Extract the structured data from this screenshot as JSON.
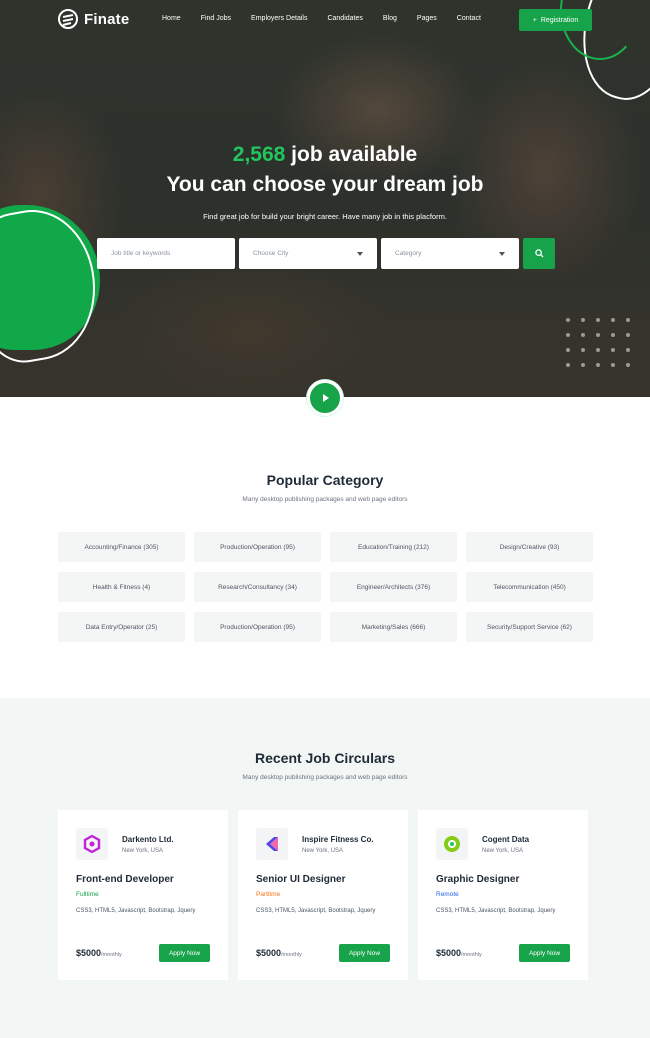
{
  "brand": {
    "name": "Finate",
    "accent": "#16a34a"
  },
  "nav": {
    "items": [
      "Home",
      "Find Jobs",
      "Employers Details",
      "Candidates",
      "Blog",
      "Pages",
      "Contact"
    ],
    "register_label": "Registration"
  },
  "hero": {
    "count": "2,568",
    "headline_rest": "job available",
    "headline_line2": "You can choose your dream job",
    "subtitle": "Find great job for build your bright career. Have many job in this placform.",
    "search": {
      "keyword_placeholder": "Job title or keywords",
      "city_placeholder": "Choose City",
      "category_placeholder": "Category"
    }
  },
  "categories": {
    "title": "Popular Category",
    "subtitle": "Many desktop publishing packages and web page editors",
    "items": [
      "Accounting/Finance (305)",
      "Production/Operation (95)",
      "Education/Training (212)",
      "Design/Creative (93)",
      "Health & Fitness (4)",
      "Research/Consultancy (34)",
      "Engineer/Architects (376)",
      "Telecommunication (450)",
      "Data Entry/Operator (25)",
      "Production/Operation (95)",
      "Marketing/Sales (666)",
      "Security/Support Service (62)"
    ]
  },
  "jobs": {
    "title": "Recent Job Circulars",
    "subtitle": "Many desktop publishing packages and web page editors",
    "cards": [
      {
        "company": "Darkento Ltd.",
        "location": "New York, USA",
        "title": "Front-end Developer",
        "type": "Fulltime",
        "type_color": "#16a34a",
        "skills": "CSS3, HTML5, Javascript, Bootstrap, Jquery",
        "salary": "$5000",
        "period": "/monthly",
        "apply_label": "Apply Now",
        "logo_color": "#c026d3"
      },
      {
        "company": "Inspire Fitness Co.",
        "location": "New York, USA",
        "title": "Senior UI Designer",
        "type": "Parttime",
        "type_color": "#f97316",
        "skills": "CSS3, HTML5, Javascript, Bootstrap, Jquery",
        "salary": "$5000",
        "period": "/monthly",
        "apply_label": "Apply Now",
        "logo_color": "#4f46e5"
      },
      {
        "company": "Cogent Data",
        "location": "New York, USA",
        "title": "Graphic Designer",
        "type": "Remote",
        "type_color": "#2563eb",
        "skills": "CSS3, HTML5, Javascript, Bootstrap, Jquery",
        "salary": "$5000",
        "period": "/monthly",
        "apply_label": "Apply Now",
        "logo_color": "#84cc16"
      }
    ]
  }
}
